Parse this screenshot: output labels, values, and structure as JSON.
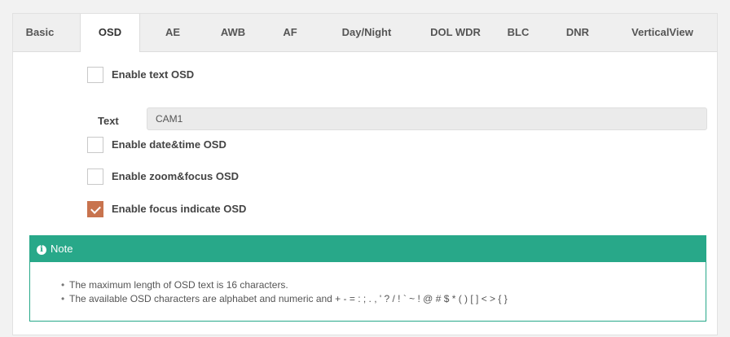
{
  "tabs": [
    {
      "label": "Basic",
      "active": false
    },
    {
      "label": "OSD",
      "active": true
    },
    {
      "label": "AE",
      "active": false
    },
    {
      "label": "AWB",
      "active": false
    },
    {
      "label": "AF",
      "active": false
    },
    {
      "label": "Day/Night",
      "active": false
    },
    {
      "label": "DOL WDR",
      "active": false
    },
    {
      "label": "BLC",
      "active": false
    },
    {
      "label": "DNR",
      "active": false
    },
    {
      "label": "VerticalView",
      "active": false
    }
  ],
  "options": {
    "text_osd": {
      "label": "Enable text OSD",
      "checked": false
    },
    "date_time_osd": {
      "label": "Enable date&time OSD",
      "checked": false
    },
    "zoom_focus_osd": {
      "label": "Enable zoom&focus OSD",
      "checked": false
    },
    "focus_indicate_osd": {
      "label": "Enable focus indicate OSD",
      "checked": true
    }
  },
  "text_field": {
    "label": "Text",
    "value": "CAM1"
  },
  "note": {
    "title": "Note",
    "items": [
      "The maximum length of OSD text is 16 characters.",
      "The available OSD characters are alphabet and numeric and + - = : ; . , ' ? / ! ` ~ ! @ # $ * ( ) [ ] < > { }"
    ]
  },
  "colors": {
    "accent": "#28a889",
    "checkbox_checked": "#c8734e"
  }
}
